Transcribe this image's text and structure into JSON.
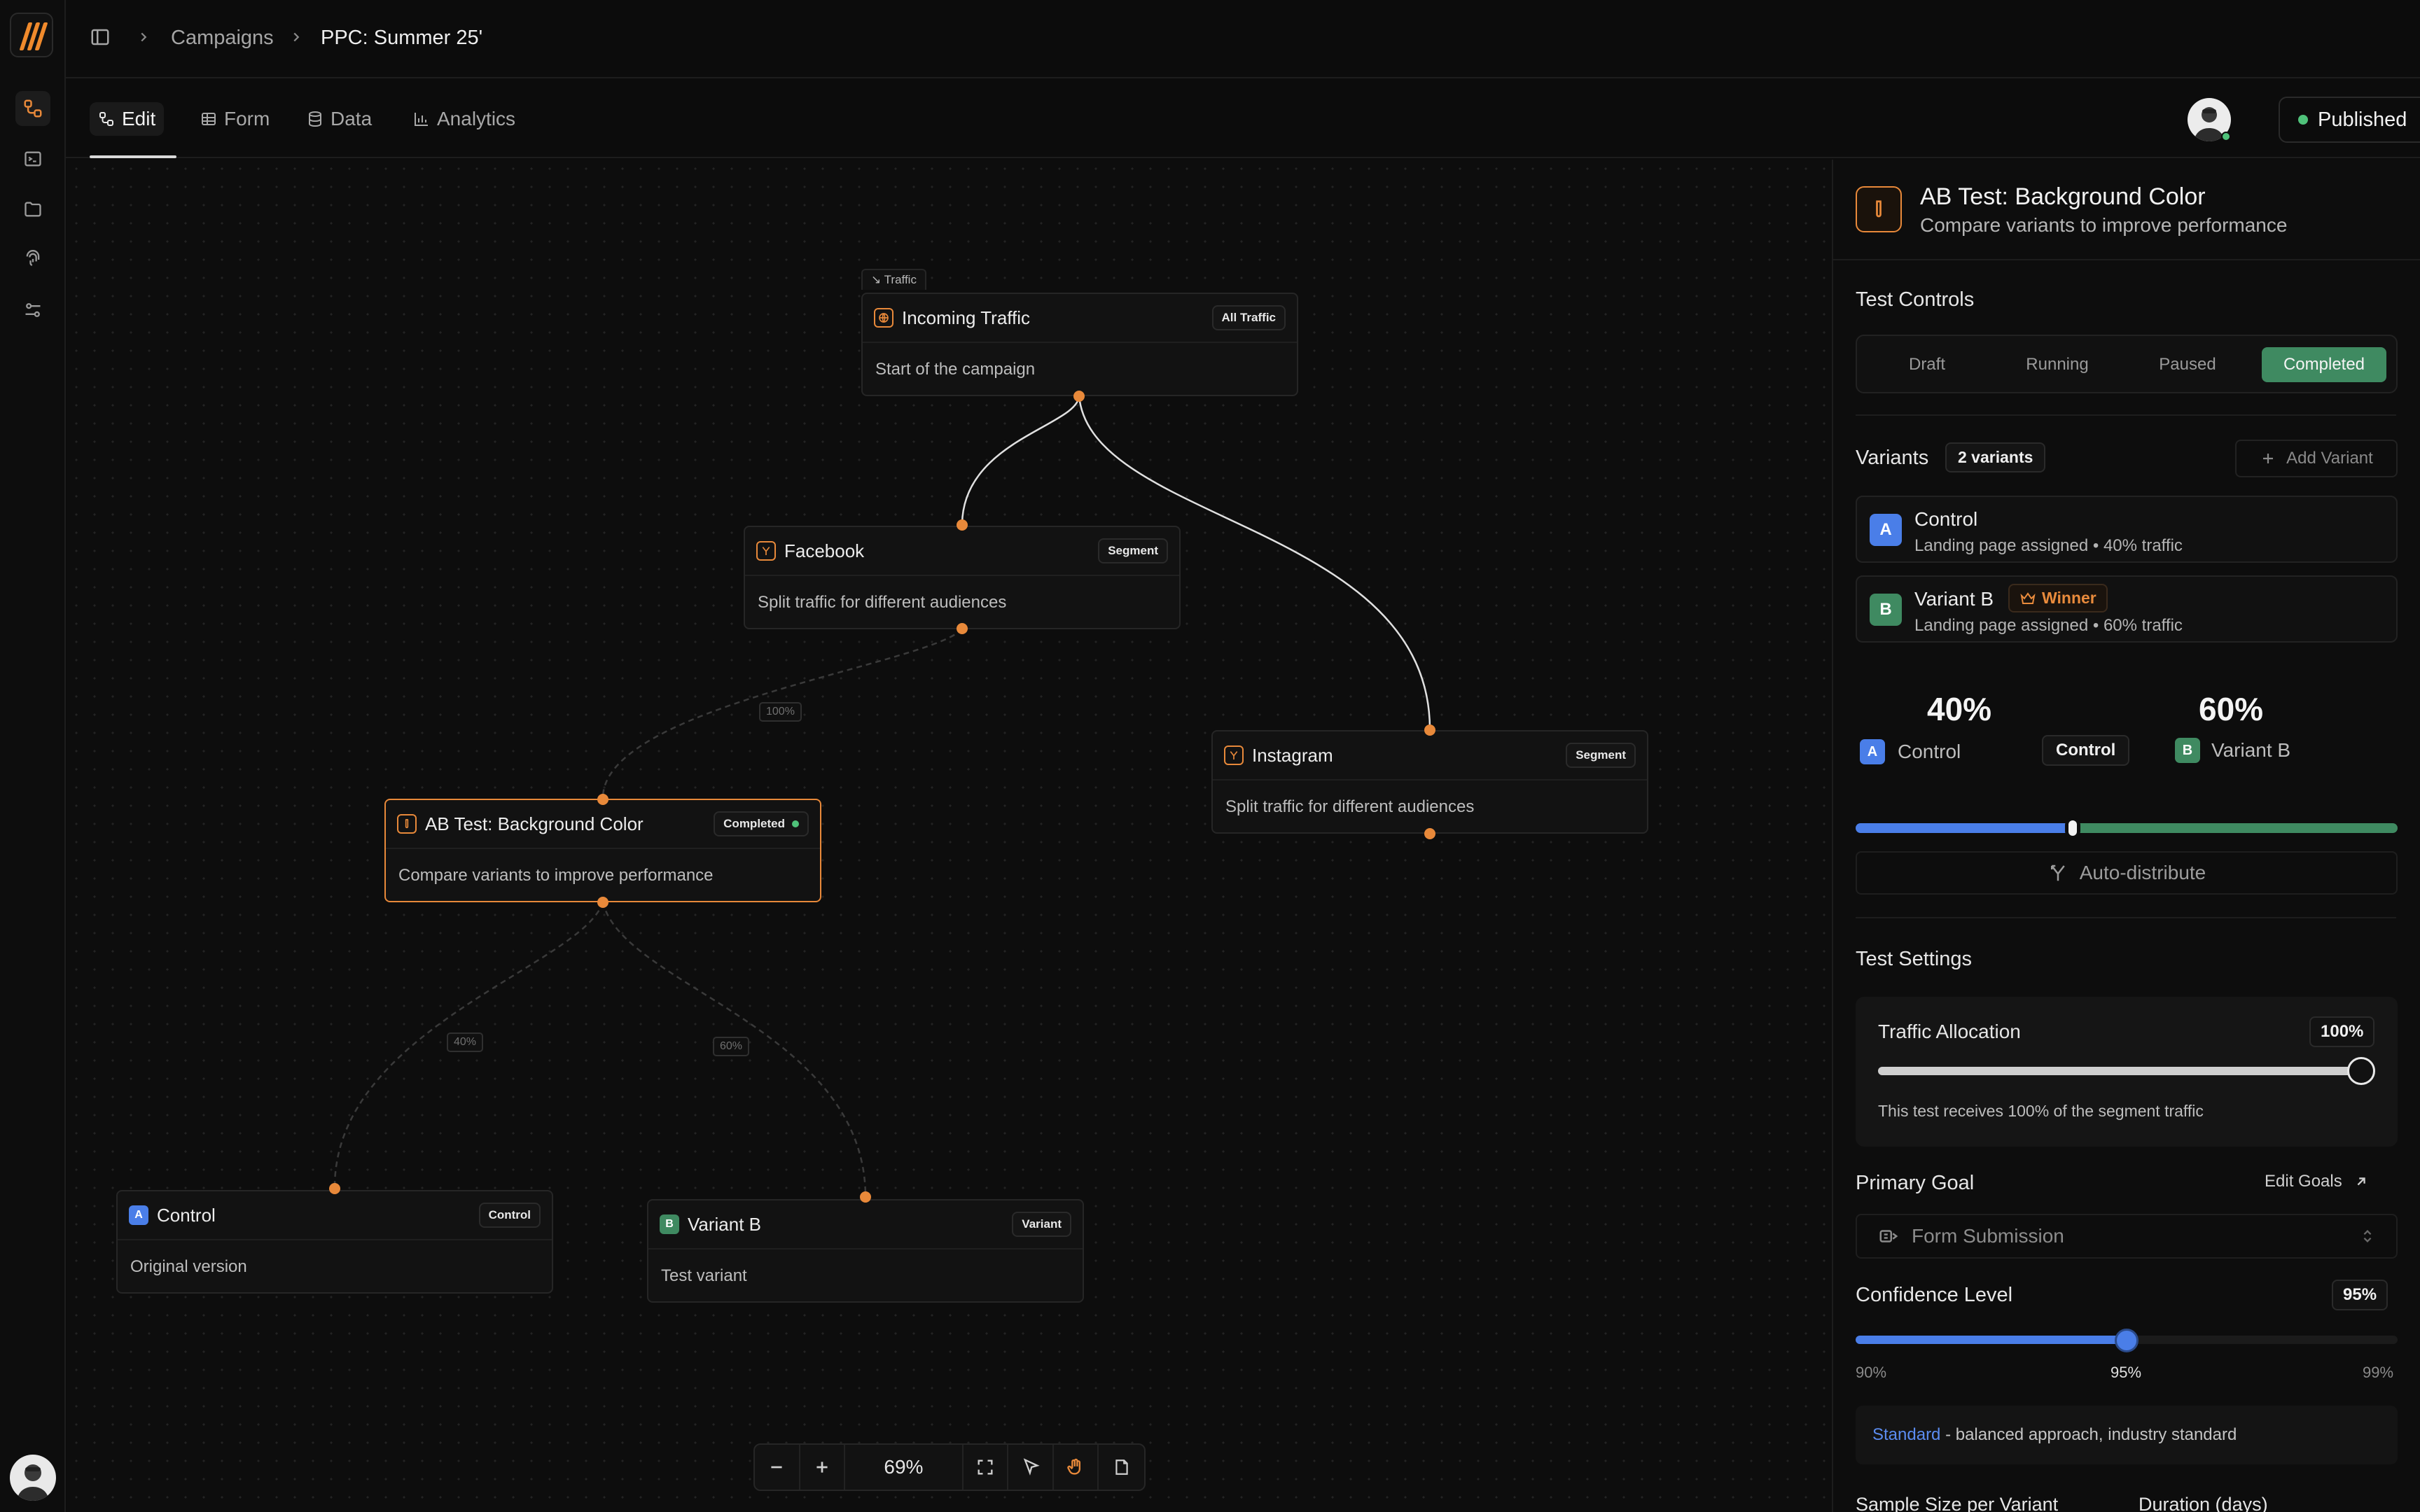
{
  "breadcrumb": [
    "Campaigns",
    "PPC: Summer 25'"
  ],
  "tabs": [
    "Edit",
    "Form",
    "Data",
    "Analytics"
  ],
  "status_button": "Published",
  "canvas": {
    "traffic_tag": "Traffic",
    "nodes": {
      "incoming": {
        "title": "Incoming Traffic",
        "badge": "All Traffic",
        "desc": "Start of the campaign"
      },
      "facebook": {
        "title": "Facebook",
        "badge": "Segment",
        "desc": "Split traffic for different audiences"
      },
      "instagram": {
        "title": "Instagram",
        "badge": "Segment",
        "desc": "Split traffic for different audiences"
      },
      "abtest": {
        "title": "AB Test: Background Color",
        "badge": "Completed",
        "desc": "Compare variants to improve performance"
      },
      "control": {
        "letter": "A",
        "title": "Control",
        "badge": "Control",
        "desc": "Original version"
      },
      "variantb": {
        "letter": "B",
        "title": "Variant B",
        "badge": "Variant",
        "desc": "Test variant"
      }
    },
    "edge_labels": {
      "fb_to_ab": "100%",
      "ab_to_control": "40%",
      "ab_to_variant": "60%"
    },
    "zoom": "69%"
  },
  "panel": {
    "title": "AB Test: Background Color",
    "subtitle": "Compare variants to improve performance",
    "test_controls": {
      "label": "Test Controls",
      "options": [
        "Draft",
        "Running",
        "Paused",
        "Completed"
      ],
      "selected": "Completed"
    },
    "variants": {
      "label": "Variants",
      "count": "2 variants",
      "add_label": "Add Variant",
      "items": [
        {
          "letter": "A",
          "name": "Control",
          "sub": "Landing page assigned • 40% traffic"
        },
        {
          "letter": "B",
          "name": "Variant B",
          "sub": "Landing page assigned • 60% traffic",
          "winner": "Winner"
        }
      ]
    },
    "split": {
      "a_pct": "40%",
      "a_name": "Control",
      "a_tag": "Control",
      "b_pct": "60%",
      "b_name": "Variant B",
      "value": 0.4,
      "auto": "Auto-distribute"
    },
    "settings": {
      "label": "Test Settings",
      "traffic_label": "Traffic Allocation",
      "traffic_value": "100%",
      "traffic_fraction": 1.0,
      "traffic_note": "This test receives 100% of the segment traffic",
      "goal_label": "Primary Goal",
      "goal_edit": "Edit Goals",
      "goal_value": "Form Submission",
      "confidence_label": "Confidence Level",
      "confidence_value": "95%",
      "confidence_fraction": 0.5,
      "ticks": [
        "90%",
        "95%",
        "99%"
      ],
      "standard_word": "Standard",
      "standard_text": " - balanced approach, industry standard",
      "sample_label": "Sample Size per Variant",
      "duration_label": "Duration (days)"
    }
  },
  "colors": {
    "accent": "#e8893a",
    "blue": "#4a7ee8",
    "green": "#3f8a61",
    "status_green": "#4fc27a"
  }
}
